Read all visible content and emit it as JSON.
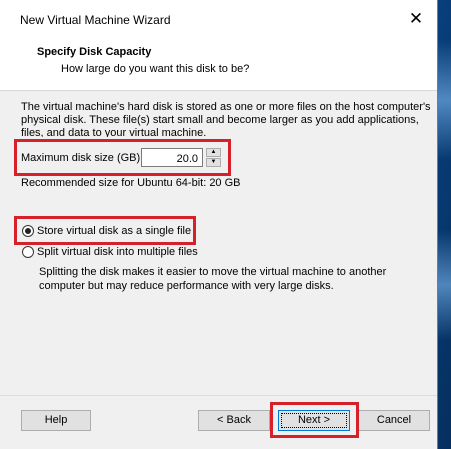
{
  "window": {
    "title": "New Virtual Machine Wizard",
    "close_glyph": "✕"
  },
  "header": {
    "title": "Specify Disk Capacity",
    "subtitle": "How large do you want this disk to be?"
  },
  "body": {
    "description": "The virtual machine's hard disk is stored as one or more files on the host computer's physical disk. These file(s) start small and become larger as you add applications, files, and data to your virtual machine.",
    "max_size_label": "Maximum disk size (GB):",
    "max_size_value": "20.0",
    "recommended": "Recommended size for Ubuntu 64-bit: 20 GB",
    "options": [
      {
        "label": "Store virtual disk as a single file",
        "selected": true
      },
      {
        "label": "Split virtual disk into multiple files",
        "selected": false
      }
    ],
    "split_description": "Splitting the disk makes it easier to move the virtual machine to another computer but may reduce performance with very large disks."
  },
  "buttons": {
    "help": "Help",
    "back": "< Back",
    "next": "Next >",
    "cancel": "Cancel"
  },
  "colors": {
    "highlight": "#d6202a",
    "focus": "#0078d7"
  }
}
